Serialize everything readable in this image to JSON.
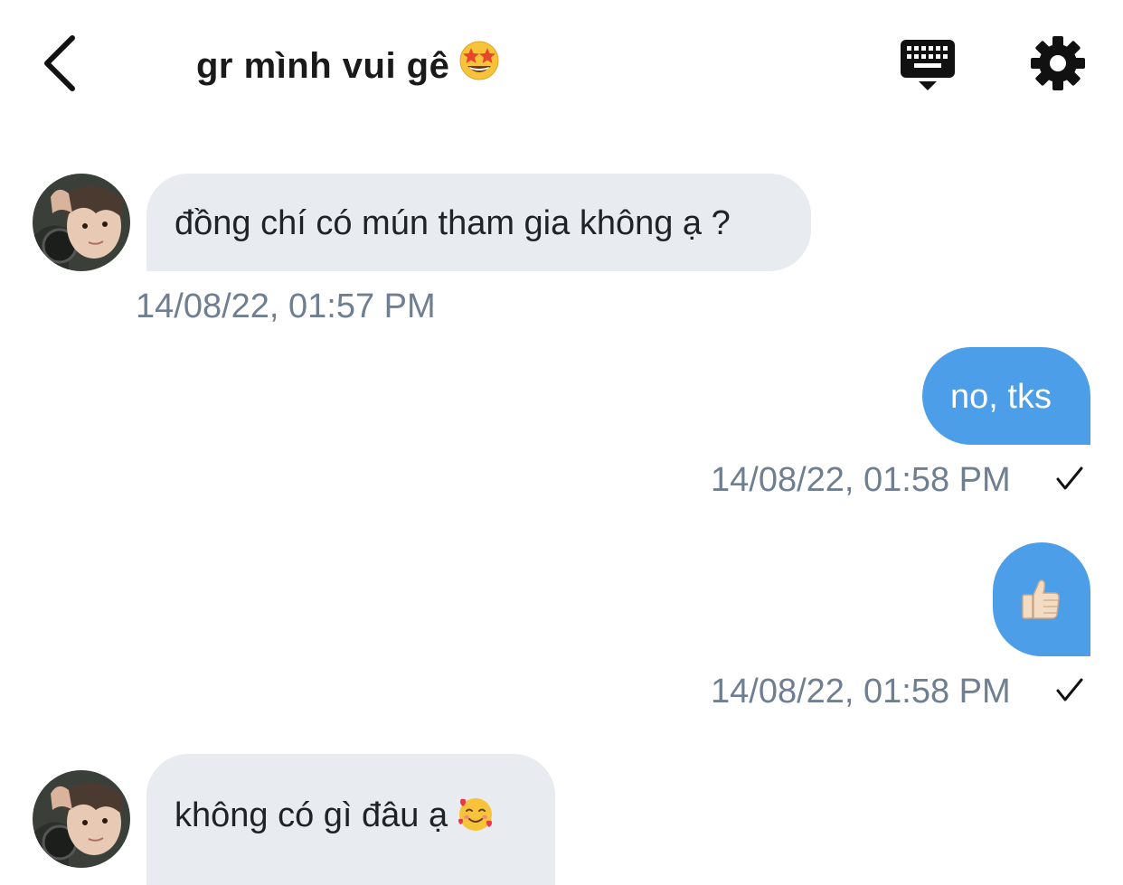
{
  "header": {
    "title": "gr mình vui gê",
    "title_emoji": "star-struck-emoji"
  },
  "icons": {
    "back": "chevron-left-icon",
    "keyboard": "keyboard-hide-icon",
    "settings": "gear-icon"
  },
  "colors": {
    "incoming_bubble": "#e8ebef",
    "outgoing_bubble": "#4d9ee8",
    "timestamp": "#6f7f91"
  },
  "messages": [
    {
      "direction": "incoming",
      "text": "đồng chí có mún tham gia không ạ ?",
      "timestamp": "14/08/22, 01:57 PM"
    },
    {
      "direction": "outgoing",
      "text": "no, tks",
      "timestamp": "14/08/22, 01:58 PM",
      "status": "sent-check"
    },
    {
      "direction": "outgoing",
      "emoji": "thumbs-up-emoji",
      "timestamp": "14/08/22, 01:58 PM",
      "status": "sent-check"
    },
    {
      "direction": "incoming",
      "text": "không có gì đâu ạ",
      "emoji": "smiling-face-with-hearts-emoji"
    }
  ]
}
